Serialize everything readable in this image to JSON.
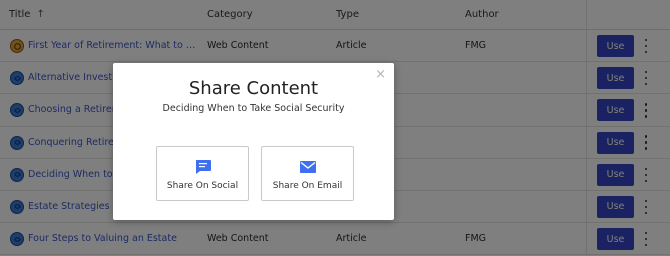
{
  "table": {
    "headers": {
      "title": "Title",
      "category": "Category",
      "type": "Type",
      "author": "Author"
    },
    "rows": [
      {
        "title": "First Year of Retirement: What to Exp...",
        "category": "Web Content",
        "type": "Article",
        "author": "FMG",
        "action": "Use",
        "icon": "coin-icon"
      },
      {
        "title": "Alternative Investm",
        "category": "",
        "type": "",
        "author": "",
        "action": "Use",
        "icon": "globe-icon"
      },
      {
        "title": "Choosing a Retirem",
        "category": "",
        "type": "",
        "author": "",
        "action": "Use",
        "icon": "globe-icon"
      },
      {
        "title": "Conquering Retirem",
        "category": "",
        "type": "",
        "author": "",
        "action": "Use",
        "icon": "globe-icon"
      },
      {
        "title": "Deciding When to T",
        "category": "",
        "type": "",
        "author": "",
        "action": "Use",
        "icon": "globe-icon"
      },
      {
        "title": "Estate Strategies of",
        "category": "",
        "type": "",
        "author": "",
        "action": "Use",
        "icon": "globe-icon"
      },
      {
        "title": "Four Steps to Valuing an Estate",
        "category": "Web Content",
        "type": "Article",
        "author": "FMG",
        "action": "Use",
        "icon": "globe-icon"
      }
    ]
  },
  "modal": {
    "title": "Share Content",
    "subtitle": "Deciding When to Take Social Security",
    "close": "×",
    "options": {
      "social": "Share On Social",
      "email": "Share On Email"
    }
  },
  "colors": {
    "accent": "#3645c4",
    "link": "#3a57c8",
    "icon_blue": "#3a7bd5",
    "icon_gold": "#e2a23a"
  }
}
